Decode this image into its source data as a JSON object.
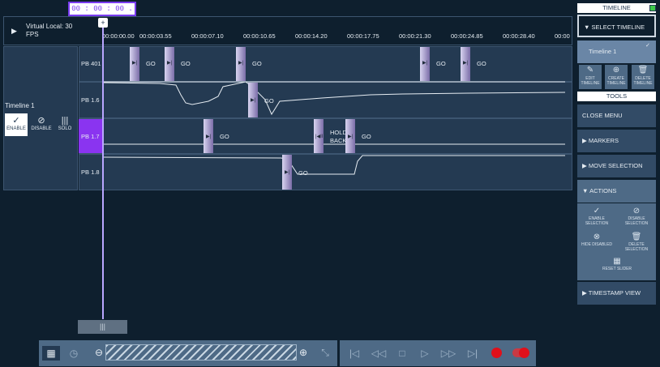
{
  "timecode": "00 : 00 : 00 . 00",
  "header": {
    "virtual_local": "Virtual Local: 30",
    "fps": "FPS",
    "ticks": [
      "00:00:00.00",
      "00:00:03.55",
      "00:00:07.10",
      "00:00:10.65",
      "00:00:14.20",
      "00:00:17.75",
      "00:00:21.30",
      "00:00:24.85",
      "00:00:28.40",
      "00:00"
    ]
  },
  "timeline": {
    "name": "Timeline 1",
    "controls": {
      "enable": "ENABLE",
      "disable": "DISABLE",
      "solo": "SOLO"
    },
    "lanes": [
      {
        "label": "PB 401"
      },
      {
        "label": "PB 1.6"
      },
      {
        "label": "PB 1.7"
      },
      {
        "label": "PB 1.8"
      }
    ],
    "cues": {
      "go": "GO",
      "hold_back": "HOLD BACK"
    }
  },
  "colors": {
    "accent": "#7a3cf0",
    "playhead": "#b9a6ff",
    "background": "#0e1f2e",
    "lane": "#243a52"
  },
  "sidebar": {
    "title": "TIMELINE",
    "select_timeline": "SELECT TIMELINE",
    "timeline_item": "Timeline 1",
    "edit_timeline": "EDIT TIMELINE",
    "create_timeline": "CREATE TIMELINE",
    "delete_timeline": "DELETE TIMELINE",
    "tools": "TOOLS",
    "close_menu": "CLOSE MENU",
    "markers": "MARKERS",
    "move_selection": "MOVE SELECTION",
    "actions": "ACTIONS",
    "enable_selection": "ENABLE SELECTION",
    "disable_selection": "DISABLE SELECTION",
    "hide_disabled": "HIDE DISABLED",
    "delete_selection": "DELETE SELECTION",
    "reset_slider": "RESET SLIDER",
    "timestamp_view": "TIMESTAMP VIEW"
  },
  "icons": [
    "grid-icon",
    "clock-icon",
    "zoom-out-icon",
    "zoom-in-icon",
    "collapse-icon",
    "skip-start-icon",
    "rewind-icon",
    "stop-icon",
    "play-icon",
    "fast-forward-icon",
    "skip-end-icon",
    "record-icon",
    "record-toggle-icon"
  ]
}
